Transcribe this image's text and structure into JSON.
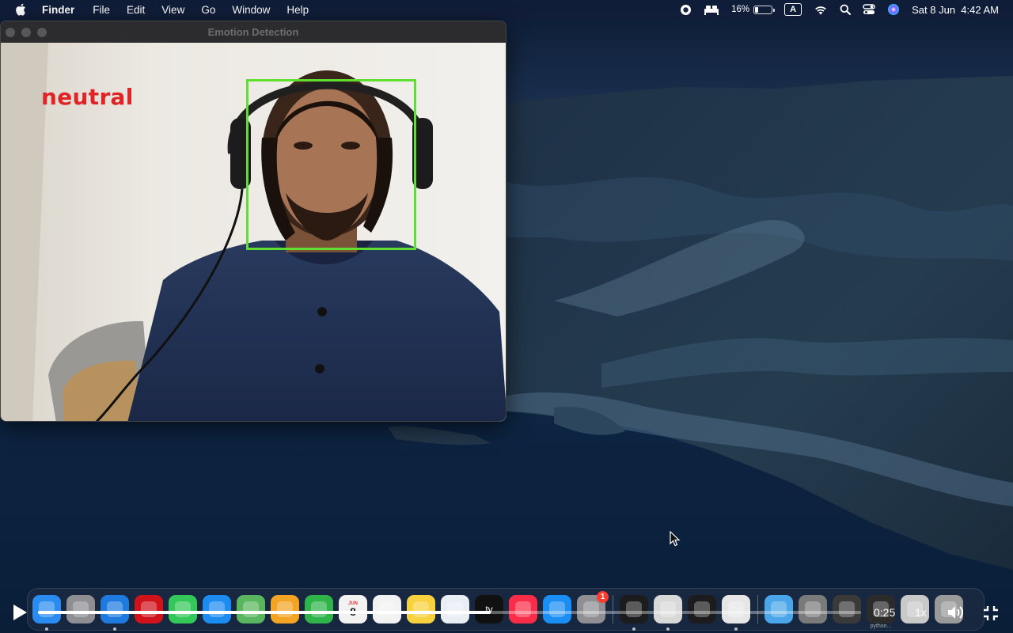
{
  "menubar": {
    "app_name": "Finder",
    "menus": [
      "File",
      "Edit",
      "View",
      "Go",
      "Window",
      "Help"
    ],
    "battery_percent": "16%",
    "battery_level": 0.16,
    "input_source": "A",
    "datetime": "Sat 8 Jun  4:42 AM",
    "status_icons": [
      "screen-record-icon",
      "bed-icon",
      "battery-icon",
      "input-source-icon",
      "wifi-icon",
      "spotlight-search-icon",
      "control-center-icon",
      "siri-icon"
    ]
  },
  "window": {
    "title": "Emotion Detection",
    "emotion_label": "neutral",
    "face_box_color": "#5fe031",
    "label_color": "#e02426"
  },
  "dock": {
    "apps": [
      {
        "name": "finder",
        "icon": "finder-icon",
        "color": "#2a8cf0",
        "running": true
      },
      {
        "name": "launchpad",
        "icon": "launchpad-icon",
        "color": "#8e8e93",
        "running": false
      },
      {
        "name": "safari",
        "icon": "safari-icon",
        "color": "#1f7ae0",
        "running": true
      },
      {
        "name": "opera",
        "icon": "opera-icon",
        "color": "#d0121b",
        "running": false
      },
      {
        "name": "messages",
        "icon": "messages-icon",
        "color": "#34c759",
        "running": false
      },
      {
        "name": "mail",
        "icon": "mail-icon",
        "color": "#1c8cf1",
        "running": false
      },
      {
        "name": "maps",
        "icon": "maps-icon",
        "color": "#5ab65e",
        "running": false
      },
      {
        "name": "photos",
        "icon": "photos-icon",
        "color": "#f4a424",
        "running": false
      },
      {
        "name": "facetime",
        "icon": "facetime-icon",
        "color": "#2fb44a",
        "running": false
      },
      {
        "name": "calendar",
        "icon": "calendar-icon",
        "color": "#f2f2f2",
        "running": false,
        "month": "JUN",
        "day": "8"
      },
      {
        "name": "reminders",
        "icon": "reminders-icon",
        "color": "#f2f2f2",
        "running": false
      },
      {
        "name": "notes",
        "icon": "notes-icon",
        "color": "#f7d23e",
        "running": false
      },
      {
        "name": "freeform",
        "icon": "freeform-icon",
        "color": "#e9eef5",
        "running": false
      },
      {
        "name": "apple-tv",
        "icon": "apple-tv-icon",
        "color": "#111111",
        "running": false,
        "label": "tv"
      },
      {
        "name": "music",
        "icon": "music-icon",
        "color": "#fa2d48",
        "running": false
      },
      {
        "name": "app-store",
        "icon": "app-store-icon",
        "color": "#1a8ef3",
        "running": false
      },
      {
        "name": "system-settings",
        "icon": "system-settings-icon",
        "color": "#8e8e93",
        "running": false,
        "badge": "1"
      }
    ],
    "running_apps": [
      {
        "name": "terminal",
        "icon": "terminal-icon",
        "color": "#1c1c1e",
        "running": true
      },
      {
        "name": "webcam",
        "icon": "webcam-icon",
        "color": "#d8d8d8",
        "running": true
      },
      {
        "name": "activity-monitor",
        "icon": "activity-monitor-icon",
        "color": "#1c1c1e",
        "running": false
      },
      {
        "name": "document",
        "icon": "document-icon",
        "color": "#e6e6e6",
        "running": true
      }
    ],
    "stack_items": [
      {
        "name": "downloads-folder",
        "icon": "folder-icon",
        "color": "#4aa6e8"
      },
      {
        "name": "preview-thumbnail",
        "icon": "preview-icon",
        "color": "#7a7a7a"
      },
      {
        "name": "screenshot-thumbnail",
        "icon": "screenshot-icon",
        "color": "#3a3a3a"
      },
      {
        "name": "python-thumbnail",
        "icon": "python-window-icon",
        "color": "#2b2b2b",
        "label": "python..."
      },
      {
        "name": "screen-thumbnail",
        "icon": "screen-thumbnail-icon",
        "color": "#c9c9c9"
      },
      {
        "name": "trash",
        "icon": "trash-icon",
        "color": "#9a9a9a"
      }
    ]
  },
  "player": {
    "current_time": "0:25",
    "progress": 0.55,
    "speed": "1x"
  }
}
